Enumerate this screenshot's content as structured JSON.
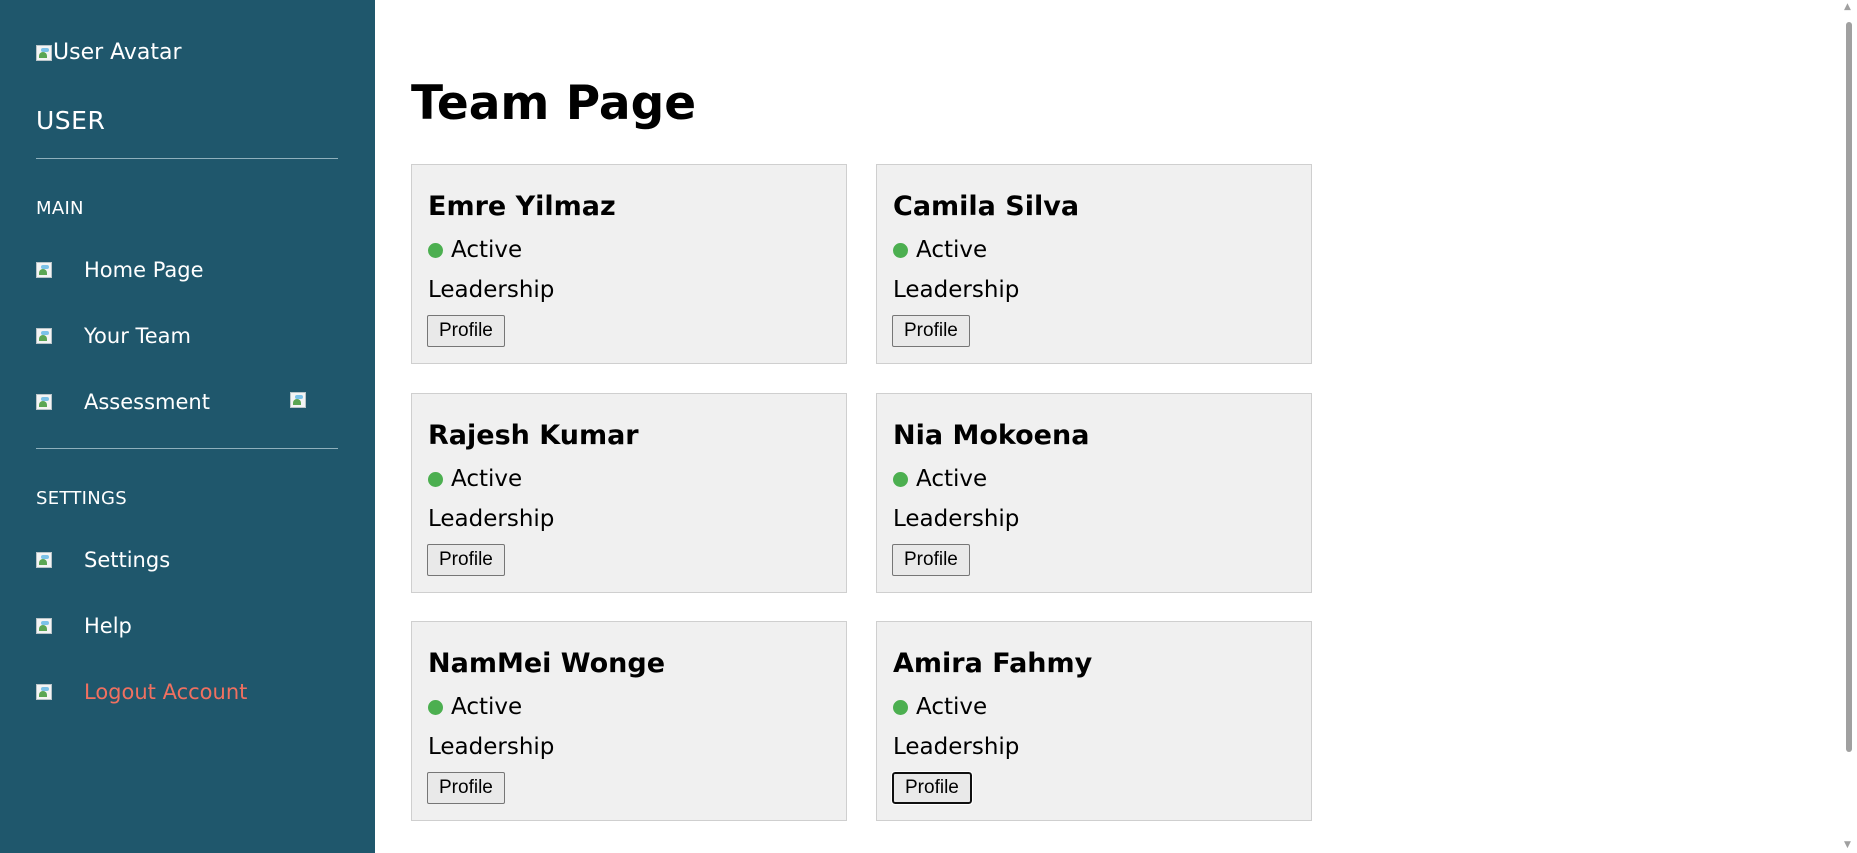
{
  "sidebar": {
    "avatar_text": "User Avatar",
    "role": "USER",
    "sections": {
      "main_label": "MAIN",
      "settings_label": "SETTINGS"
    },
    "items": {
      "home": "Home Page",
      "team": "Your Team",
      "assessment": "Assessment",
      "settings": "Settings",
      "help": "Help",
      "logout": "Logout Account"
    }
  },
  "page": {
    "title": "Team Page"
  },
  "team": [
    {
      "name": "Emre Yilmaz",
      "status": "Active",
      "department": "Leadership",
      "button": "Profile"
    },
    {
      "name": "Camila Silva",
      "status": "Active",
      "department": "Leadership",
      "button": "Profile"
    },
    {
      "name": "Rajesh Kumar",
      "status": "Active",
      "department": "Leadership",
      "button": "Profile"
    },
    {
      "name": "Nia Mokoena",
      "status": "Active",
      "department": "Leadership",
      "button": "Profile"
    },
    {
      "name": "NamMei Wonge",
      "status": "Active",
      "department": "Leadership",
      "button": "Profile"
    },
    {
      "name": "Amira Fahmy",
      "status": "Active",
      "department": "Leadership",
      "button": "Profile"
    }
  ],
  "colors": {
    "sidebar_bg": "#1f576c",
    "status_active": "#4caf50",
    "logout_text": "#f07060",
    "card_bg": "#f0f0f0"
  }
}
